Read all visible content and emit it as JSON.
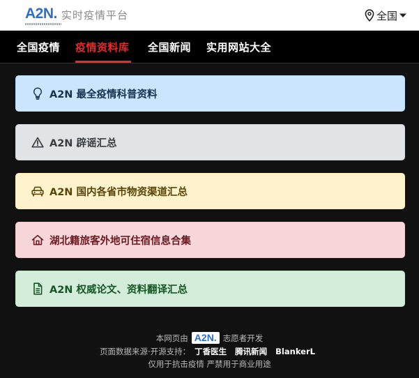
{
  "header": {
    "logo_text": "A2N",
    "title": "实时疫情平台",
    "region_label": "全国"
  },
  "nav": {
    "tabs": [
      {
        "label": "全国疫情",
        "active": false
      },
      {
        "label": "疫情资料库",
        "active": true
      },
      {
        "label": "全国新闻",
        "active": false
      },
      {
        "label": "实用网站大全",
        "active": false
      }
    ]
  },
  "cards": [
    {
      "label": "A2N 最全疫情科普资料",
      "icon": "lightbulb-icon",
      "bg": "#cce5ff",
      "fg": "#16324f"
    },
    {
      "label": "A2N 辟谣汇总",
      "icon": "warning-icon",
      "bg": "#e2e3e5",
      "fg": "#383d41"
    },
    {
      "label": "A2N 国内各省市物资渠道汇总",
      "icon": "car-icon",
      "bg": "#fff3cd",
      "fg": "#5a4508"
    },
    {
      "label": "湖北籍旅客外地可住宿信息合集",
      "icon": "home-icon",
      "bg": "#f8d7da",
      "fg": "#6b1a22"
    },
    {
      "label": "A2N 权威论文、资料翻译汇总",
      "icon": "document-icon",
      "bg": "#d4edda",
      "fg": "#155724"
    }
  ],
  "footer": {
    "line1_prefix": "本网页由",
    "line1_badge": "A2N.",
    "line1_suffix": "志愿者开发",
    "line2_prefix": "页面数据来源·开源支持：",
    "line2_links": [
      "丁香医生",
      "腾讯新闻",
      "BlankerL"
    ],
    "line3": "仅用于抗击疫情 严禁用于商业用途"
  },
  "colors": {
    "accent": "#e42a2a",
    "brand": "#2e6fc4",
    "background": "#111111"
  }
}
